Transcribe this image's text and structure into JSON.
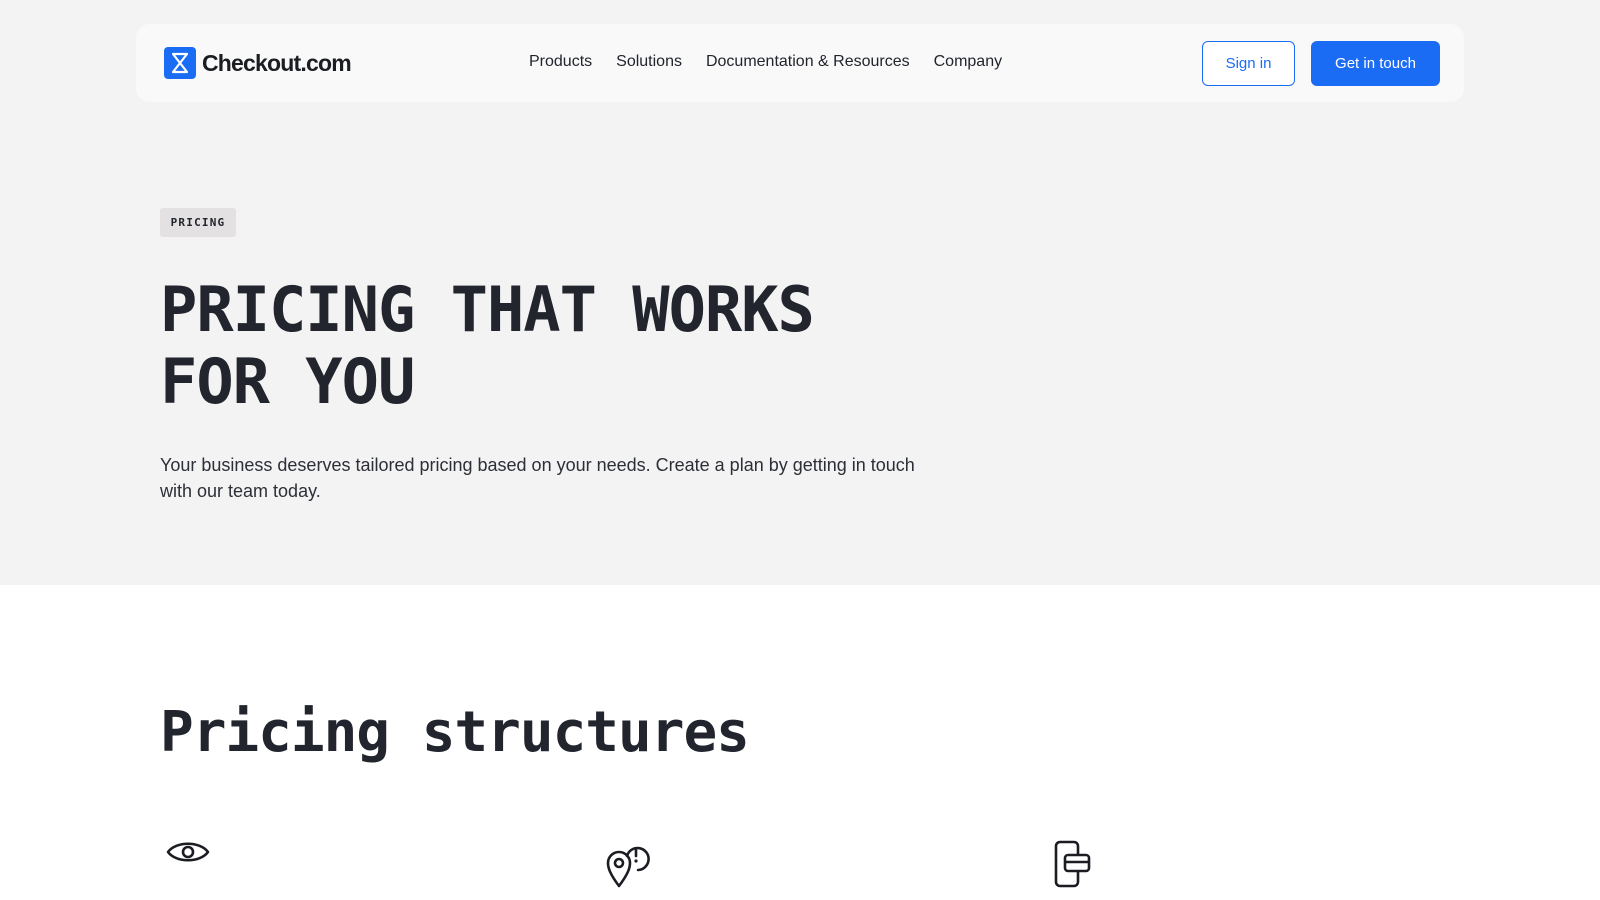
{
  "brand": {
    "name": "Checkout.com",
    "icon": "checkout-logo-icon",
    "accent_color": "#1a6cf4"
  },
  "nav": {
    "links": [
      "Products",
      "Solutions",
      "Documentation & Resources",
      "Company"
    ],
    "sign_in_label": "Sign in",
    "cta_label": "Get in touch"
  },
  "hero": {
    "badge": "PRICING",
    "title_line1": "PRICING THAT WORKS",
    "title_line2": "FOR YOU",
    "subtitle": "Your business deserves tailored pricing based on your needs. Create a plan by getting in touch with our team today.",
    "background": "#f4f3f4"
  },
  "pricing_structures": {
    "title": "Pricing structures",
    "feature_icons": [
      "eye-icon",
      "location-pin-alert-icon",
      "phone-card-icon"
    ]
  }
}
